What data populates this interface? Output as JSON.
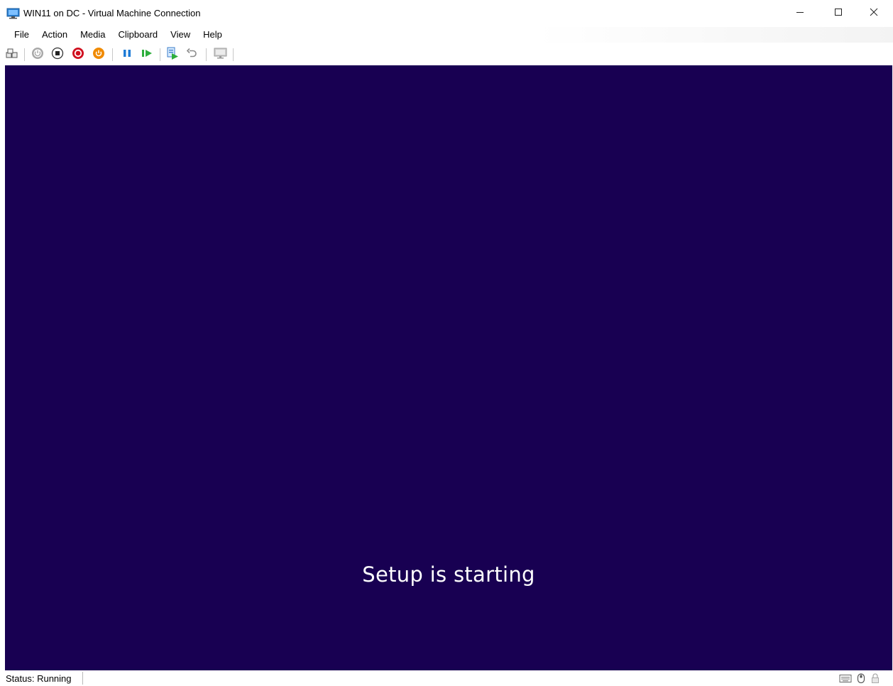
{
  "window": {
    "title": "WIN11 on DC - Virtual Machine Connection",
    "app_icon": "vm-connection-icon",
    "controls": [
      "minimize-icon",
      "maximize-icon",
      "close-icon"
    ]
  },
  "menu": {
    "items": [
      "File",
      "Action",
      "Media",
      "Clipboard",
      "View",
      "Help"
    ]
  },
  "toolbar": {
    "buttons": [
      {
        "icon": "ctrl-alt-del-icon"
      },
      {
        "icon": "start-icon",
        "color": "#9a9a9a"
      },
      {
        "icon": "turn-off-icon",
        "color": "#222222"
      },
      {
        "icon": "shut-down-icon",
        "color": "#d0101f"
      },
      {
        "icon": "save-icon",
        "color": "#f08a00"
      },
      {
        "icon": "pause-icon",
        "color": "#1e7bd6"
      },
      {
        "icon": "reset-icon",
        "color": "#2eae3c"
      },
      {
        "icon": "checkpoint-icon",
        "color": "#2eae3c"
      },
      {
        "icon": "revert-icon",
        "color": "#8a8a8a"
      },
      {
        "icon": "enhanced-session-icon",
        "color": "#a0a0a0"
      }
    ]
  },
  "screen": {
    "background": "#180052",
    "message": "Setup is starting"
  },
  "status": {
    "text": "Status: Running",
    "icons": [
      "keyboard-icon",
      "mouse-icon",
      "lock-icon"
    ]
  }
}
